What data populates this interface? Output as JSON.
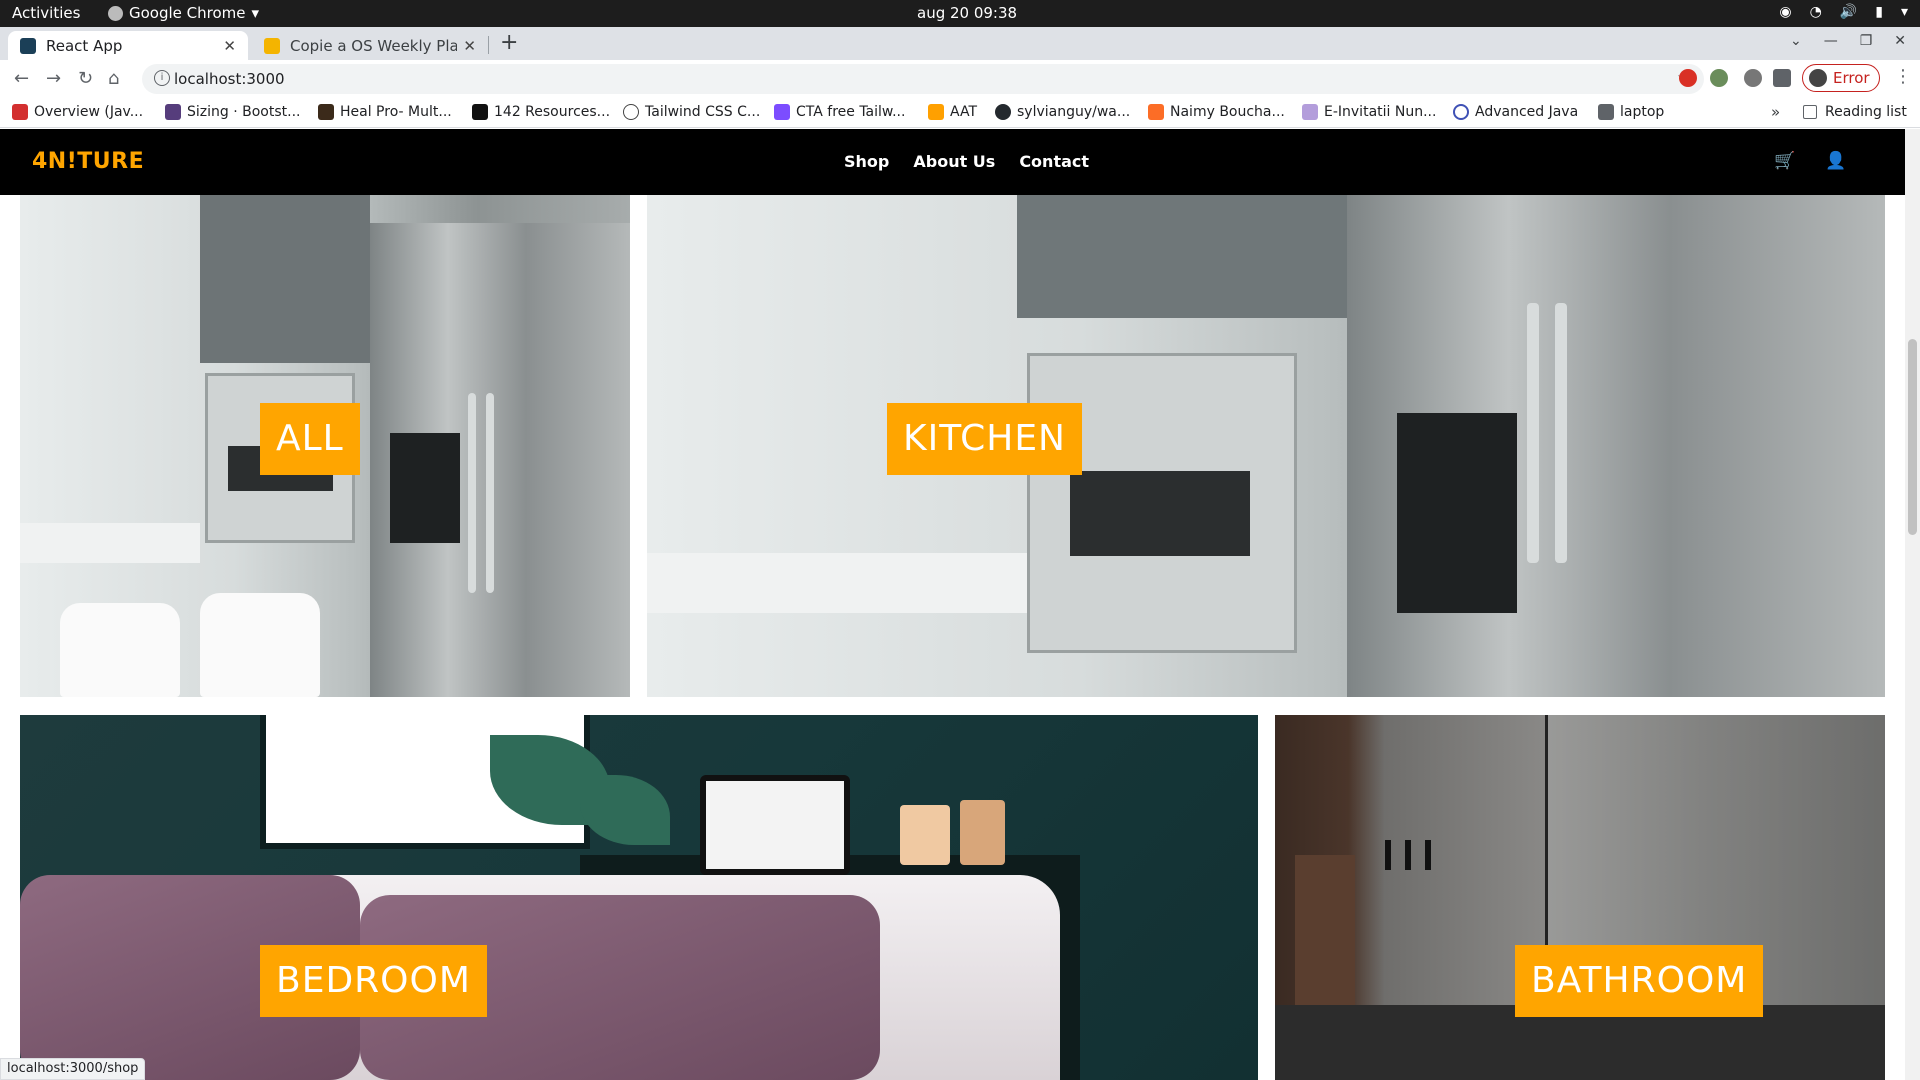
{
  "system_bar": {
    "activities": "Activities",
    "app_name": "Google Chrome",
    "clock": "aug 20  09:38"
  },
  "browser": {
    "tabs": [
      {
        "title": "React App",
        "active": true
      },
      {
        "title": "Copie a OS Weekly Planne",
        "active": false
      }
    ],
    "address": "localhost:3000",
    "profile_label": "Error",
    "bookmarks": [
      "Overview (Jav...",
      "Sizing · Bootst...",
      "Heal Pro- Mult...",
      "142 Resources...",
      "Tailwind CSS C...",
      "CTA free Tailw...",
      "AAT",
      "sylvianguy/wa...",
      "Naimy Boucha...",
      "E-Invitatii Nun...",
      "Advanced Java",
      "laptop"
    ],
    "bookmarks_more": "»",
    "reading_list": "Reading list",
    "status_url": "localhost:3000/shop"
  },
  "site": {
    "brand": "4N!TURE",
    "nav": [
      "Shop",
      "About Us",
      "Contact"
    ],
    "brand_color": "#ffa500",
    "categories": [
      {
        "label": "ALL"
      },
      {
        "label": "KITCHEN"
      },
      {
        "label": "BEDROOM"
      },
      {
        "label": "BATHROOM"
      }
    ]
  }
}
